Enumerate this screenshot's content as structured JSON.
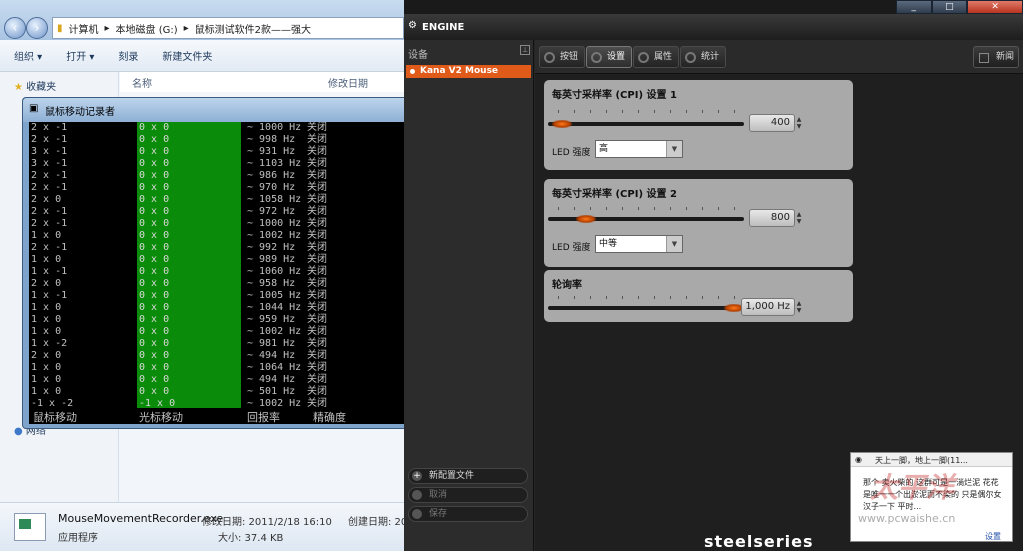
{
  "explorer": {
    "address": [
      "计算机",
      "本地磁盘 (G:)",
      "鼠标测试软件2款——强大"
    ],
    "toolbar": [
      "组织 ▾",
      "打开 ▾",
      "刻录",
      "新建文件夹"
    ],
    "nav": {
      "favorites": "收藏夹",
      "network": "网络"
    },
    "columns": {
      "name": "名称",
      "modified": "修改日期"
    },
    "details": {
      "filename": "MouseMovementRecorder.exe",
      "modified_label": "修改日期: 2011/2/18 16:10",
      "created_label": "创建日期: 20",
      "type": "应用程序",
      "size": "大小: 37.4 KB"
    }
  },
  "console": {
    "title": "鼠标移动记录者",
    "minimize": "▁",
    "maximize": "□",
    "close": "✕",
    "rows": [
      [
        "2 x -1",
        "0 x 0",
        "~ 1000 Hz",
        "关闭"
      ],
      [
        "2 x -1",
        "0 x 0",
        "~ 998 Hz",
        "关闭"
      ],
      [
        "3 x -1",
        "0 x 0",
        "~ 931 Hz",
        "关闭"
      ],
      [
        "3 x -1",
        "0 x 0",
        "~ 1103 Hz",
        "关闭"
      ],
      [
        "2 x -1",
        "0 x 0",
        "~ 986 Hz",
        "关闭"
      ],
      [
        "2 x -1",
        "0 x 0",
        "~ 970 Hz",
        "关闭"
      ],
      [
        "2 x 0",
        "0 x 0",
        "~ 1058 Hz",
        "关闭"
      ],
      [
        "2 x -1",
        "0 x 0",
        "~ 972 Hz",
        "关闭"
      ],
      [
        "2 x -1",
        "0 x 0",
        "~ 1000 Hz",
        "关闭"
      ],
      [
        "1 x 0",
        "0 x 0",
        "~ 1002 Hz",
        "关闭"
      ],
      [
        "2 x -1",
        "0 x 0",
        "~ 992 Hz",
        "关闭"
      ],
      [
        "1 x 0",
        "0 x 0",
        "~ 989 Hz",
        "关闭"
      ],
      [
        "1 x -1",
        "0 x 0",
        "~ 1060 Hz",
        "关闭"
      ],
      [
        "2 x 0",
        "0 x 0",
        "~ 958 Hz",
        "关闭"
      ],
      [
        "1 x -1",
        "0 x 0",
        "~ 1005 Hz",
        "关闭"
      ],
      [
        "1 x 0",
        "0 x 0",
        "~ 1044 Hz",
        "关闭"
      ],
      [
        "1 x 0",
        "0 x 0",
        "~ 959 Hz",
        "关闭"
      ],
      [
        "1 x 0",
        "0 x 0",
        "~ 1002 Hz",
        "关闭"
      ],
      [
        "1 x -2",
        "0 x 0",
        "~ 981 Hz",
        "关闭"
      ],
      [
        "2 x 0",
        "0 x 0",
        "~ 494 Hz",
        "关闭"
      ],
      [
        "1 x 0",
        "0 x 0",
        "~ 1064 Hz",
        "关闭"
      ],
      [
        "1 x 0",
        "0 x 0",
        "~ 494 Hz",
        "关闭"
      ],
      [
        "1 x 0",
        "0 x 0",
        "~ 501 Hz",
        "关闭"
      ],
      [
        "-1 x -2",
        "-1 x 0",
        "~ 1002 Hz",
        "关闭"
      ]
    ],
    "footer": [
      "鼠标移动",
      "光标移动",
      "回报率",
      "精确度"
    ]
  },
  "engine": {
    "title": "ENGINE",
    "window_controls": [
      "_",
      "□",
      "✕"
    ],
    "sidebar": {
      "header": "设备",
      "device": "Kana V2 Mouse",
      "new_config": "新配置文件",
      "cancel": "取消",
      "save": "保存"
    },
    "tabs": [
      "按钮",
      "设置",
      "属性",
      "统计"
    ],
    "news": "新闻",
    "cpi1": {
      "title": "每英寸采样率 (CPI) 设置 1",
      "value": "400",
      "led_label": "LED 强度",
      "led_value": "高",
      "level": 0.02
    },
    "cpi2": {
      "title": "每英寸采样率 (CPI) 设置 2",
      "value": "800",
      "led_label": "LED 强度",
      "led_value": "中等",
      "level": 0.16
    },
    "polling": {
      "title": "轮询率",
      "value": "1,000 Hz",
      "level": 1.0
    },
    "brand": "steelseries"
  },
  "notification": {
    "title": "天上一脚，地上一脚(11...",
    "body": "那个 卖火柴的  这群可是一淌烂泥  花花是唯一一个出淤泥而不染的  只是偶尔女汉子一下 平时...",
    "settings": "设置"
  },
  "watermark": {
    "text": "太平洋",
    "url": "www.pcwaishe.cn"
  }
}
